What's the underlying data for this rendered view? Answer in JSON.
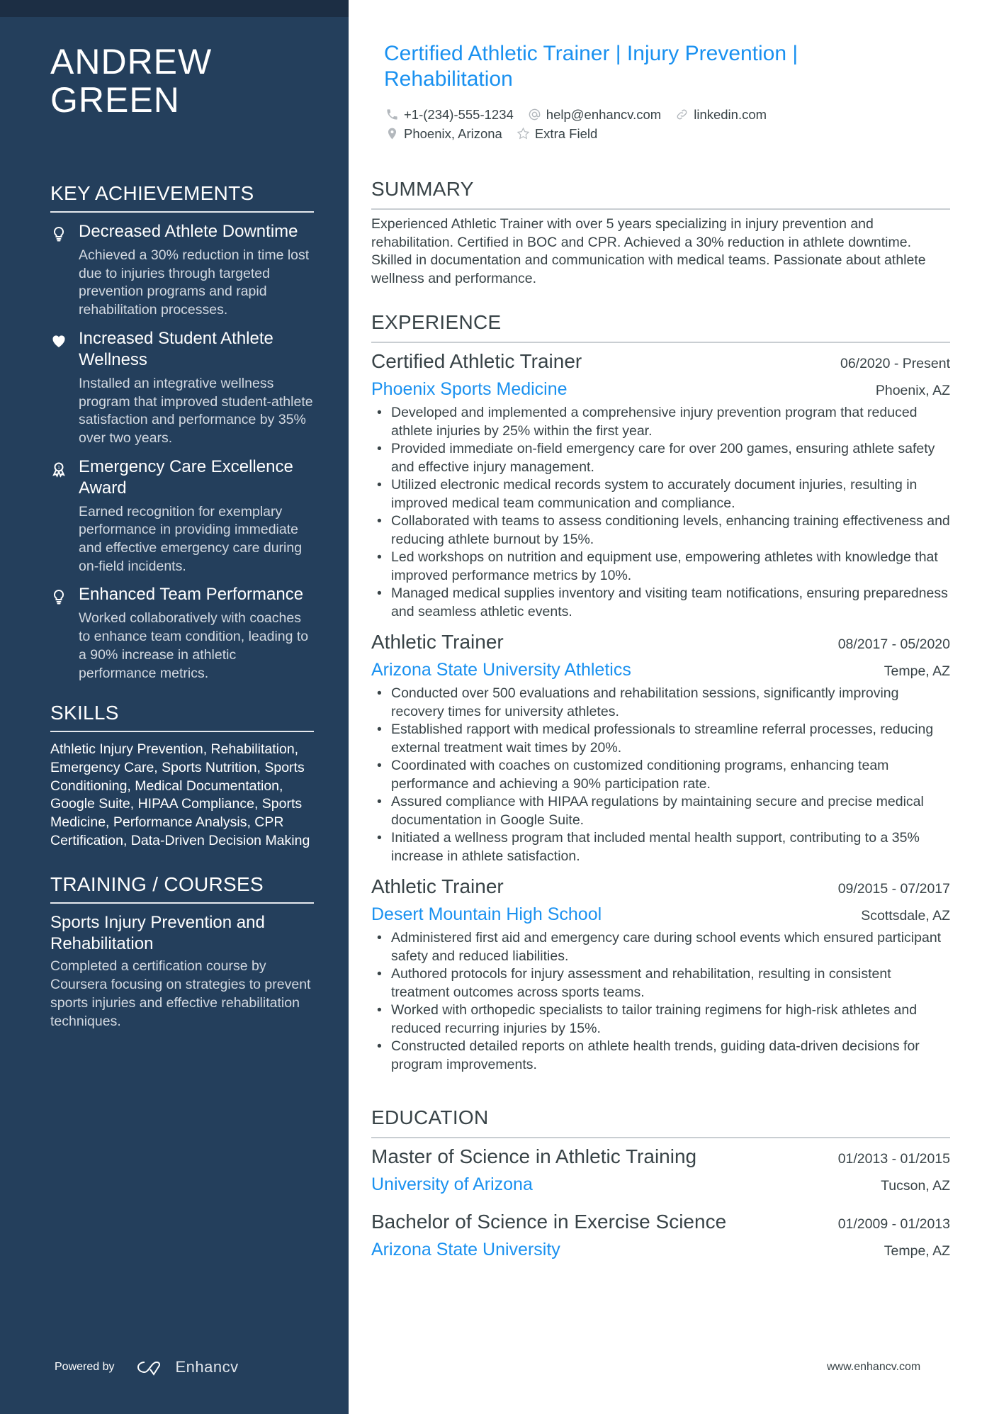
{
  "sidebar": {
    "name": "ANDREW GREEN",
    "name_line1": "ANDREW",
    "name_line2": "GREEN",
    "key_achievements": {
      "title": "KEY ACHIEVEMENTS",
      "items": [
        {
          "icon": "lightbulb-icon",
          "title": "Decreased Athlete Downtime",
          "description": "Achieved a 30% reduction in time lost due to injuries through targeted prevention programs and rapid rehabilitation processes."
        },
        {
          "icon": "heart-icon",
          "title": "Increased Student Athlete Wellness",
          "description": "Installed an integrative wellness program that improved student-athlete satisfaction and performance by 35% over two years."
        },
        {
          "icon": "award-medal-icon",
          "title": "Emergency Care Excellence Award",
          "description": "Earned recognition for exemplary performance in providing immediate and effective emergency care during on-field incidents."
        },
        {
          "icon": "lightbulb-icon",
          "title": "Enhanced Team Performance",
          "description": "Worked collaboratively with coaches to enhance team condition, leading to a 90% increase in athletic performance metrics."
        }
      ]
    },
    "skills": {
      "title": "SKILLS",
      "text": "Athletic Injury Prevention, Rehabilitation, Emergency Care, Sports Nutrition, Sports Conditioning, Medical Documentation, Google Suite, HIPAA Compliance, Sports Medicine, Performance Analysis, CPR Certification, Data-Driven Decision Making"
    },
    "training": {
      "title": "TRAINING / COURSES",
      "items": [
        {
          "title": "Sports Injury Prevention and Rehabilitation",
          "description": "Completed a certification course by Coursera focusing on strategies to prevent sports injuries and effective rehabilitation techniques."
        }
      ]
    },
    "footer": {
      "powered_by": "Powered by",
      "brand": "Enhancv"
    }
  },
  "header": {
    "headline": "Certified Athletic Trainer | Injury Prevention | Rehabilitation",
    "contacts": {
      "phone": "+1-(234)-555-1234",
      "email": "help@enhancv.com",
      "link": "linkedin.com",
      "location": "Phoenix, Arizona",
      "extra": "Extra Field"
    }
  },
  "summary": {
    "title": "SUMMARY",
    "text": "Experienced Athletic Trainer with over 5 years specializing in injury prevention and rehabilitation. Certified in BOC and CPR. Achieved a 30% reduction in athlete downtime. Skilled in documentation and communication with medical teams. Passionate about athlete wellness and performance."
  },
  "experience": {
    "title": "EXPERIENCE",
    "jobs": [
      {
        "title": "Certified Athletic Trainer",
        "dates": "06/2020 - Present",
        "company": "Phoenix Sports Medicine",
        "location": "Phoenix, AZ",
        "bullets": [
          "Developed and implemented a comprehensive injury prevention program that reduced athlete injuries by 25% within the first year.",
          "Provided immediate on-field emergency care for over 200 games, ensuring athlete safety and effective injury management.",
          "Utilized electronic medical records system to accurately document injuries, resulting in improved medical team communication and compliance.",
          "Collaborated with teams to assess conditioning levels, enhancing training effectiveness and reducing athlete burnout by 15%.",
          "Led workshops on nutrition and equipment use, empowering athletes with knowledge that improved performance metrics by 10%.",
          "Managed medical supplies inventory and visiting team notifications, ensuring preparedness and seamless athletic events."
        ]
      },
      {
        "title": "Athletic Trainer",
        "dates": "08/2017 - 05/2020",
        "company": "Arizona State University Athletics",
        "location": "Tempe, AZ",
        "bullets": [
          "Conducted over 500 evaluations and rehabilitation sessions, significantly improving recovery times for university athletes.",
          "Established rapport with medical professionals to streamline referral processes, reducing external treatment wait times by 20%.",
          "Coordinated with coaches on customized conditioning programs, enhancing team performance and achieving a 90% participation rate.",
          "Assured compliance with HIPAA regulations by maintaining secure and precise medical documentation in Google Suite.",
          "Initiated a wellness program that included mental health support, contributing to a 35% increase in athlete satisfaction."
        ]
      },
      {
        "title": "Athletic Trainer",
        "dates": "09/2015 - 07/2017",
        "company": "Desert Mountain High School",
        "location": "Scottsdale, AZ",
        "bullets": [
          "Administered first aid and emergency care during school events which ensured participant safety and reduced liabilities.",
          "Authored protocols for injury assessment and rehabilitation, resulting in consistent treatment outcomes across sports teams.",
          "Worked with orthopedic specialists to tailor training regimens for high-risk athletes and reduced recurring injuries by 15%.",
          "Constructed detailed reports on athlete health trends, guiding data-driven decisions for program improvements."
        ]
      }
    ]
  },
  "education": {
    "title": "EDUCATION",
    "items": [
      {
        "degree": "Master of Science in Athletic Training",
        "dates": "01/2013 - 01/2015",
        "school": "University of Arizona",
        "location": "Tucson, AZ"
      },
      {
        "degree": "Bachelor of Science in Exercise Science",
        "dates": "01/2009 - 01/2013",
        "school": "Arizona State University",
        "location": "Tempe, AZ"
      }
    ]
  },
  "footer": {
    "website": "www.enhancv.com"
  },
  "colors": {
    "sidebar_bg": "#243f5c",
    "accent": "#1a91f0",
    "text": "#384347"
  }
}
